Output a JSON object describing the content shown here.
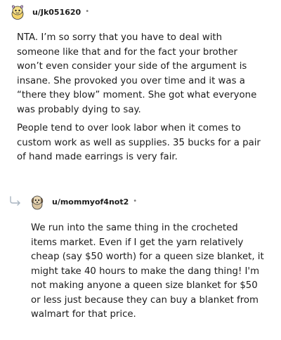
{
  "comments": [
    {
      "username": "u/Jk051620",
      "separator": "•",
      "paragraphs": [
        [
          "NTA. I’m so sorry that you have to deal with",
          "someone like that and for the fact your brother",
          "won’t even consider your side of the argument is",
          "insane. She provoked you over time and it was a",
          "“there they blow” moment. She got what everyone",
          "was probably dying to say."
        ],
        [
          "People tend to over look labor when it comes to",
          "custom work as well as supplies. 35 bucks for a pair",
          "of hand made earrings is very fair."
        ]
      ]
    },
    {
      "username": "u/mommyof4not2",
      "separator": "•",
      "paragraphs": [
        [
          "We run into the same thing in the crocheted",
          "items market. Even if I get the yarn relatively",
          "cheap (say $50 worth) for a queen size blanket, it",
          "might take 40 hours to make the dang thing! I'm",
          "not making anyone a queen size blanket for $50",
          "or less just because they can buy a blanket from",
          "walmart for that price."
        ]
      ]
    }
  ],
  "icons": {
    "reply": "reply-arrow-icon",
    "avatar1": "snoo-avatar",
    "avatar2": "snoo-dog-avatar"
  },
  "colors": {
    "text": "#1c1c1c",
    "meta": "#7c7c7c",
    "reply_arrow": "#a8b4c0"
  }
}
